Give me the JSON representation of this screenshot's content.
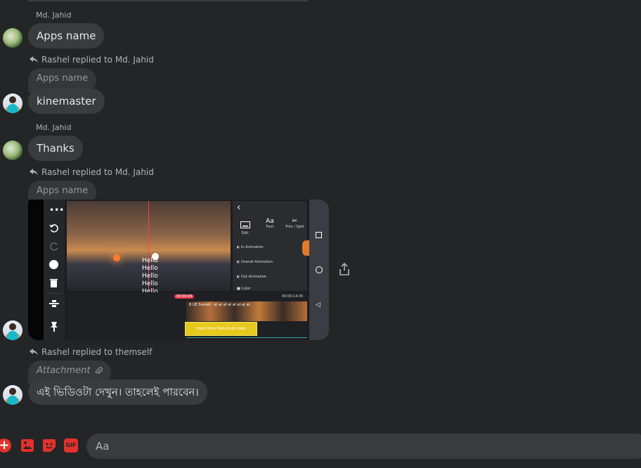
{
  "messages": {
    "m1": {
      "sender": "Md. Jahid",
      "text": "Apps name"
    },
    "m2": {
      "reply_header": "Rashel replied to Md. Jahid",
      "quoted": "Apps name",
      "text": "kinemaster"
    },
    "m3": {
      "sender": "Md. Jahid",
      "text": "Thanks"
    },
    "m4": {
      "reply_header": "Rashel replied to Md. Jahid",
      "quoted": "Apps name",
      "screenshot": {
        "hello_lines": [
          "Hello",
          "Hello",
          "Hello",
          "Hello",
          "Hello"
        ],
        "panel_tools": [
          {
            "label": "Edit",
            "icon": "keyboard-icon"
          },
          {
            "label": "Font",
            "icon": "font-icon",
            "glyph": "Aa"
          },
          {
            "label": "Trim / Split",
            "icon": "scissors-icon"
          }
        ],
        "panel_rows": [
          "In Animation",
          "Overall Animation",
          "Out Animation",
          "Color"
        ],
        "timeline_time_left": "00:00:04",
        "timeline_time_right": "00:00:14.45",
        "video_clip_label": "B  UE  Sunset · at  at  at  at  at  at  at  at",
        "text_clip_label": "Hello Hello Hello Hello Hello"
      }
    },
    "m5": {
      "reply_header": "Rashel replied to themself",
      "quoted": "Attachment",
      "text": "এই ভিডিওটা দেখুন। তাহলেই পারবেন।"
    }
  },
  "composer": {
    "placeholder": "Aa"
  },
  "colors": {
    "background": "#242526",
    "bubble": "#3a3b3c",
    "accent": "#e4312b"
  }
}
